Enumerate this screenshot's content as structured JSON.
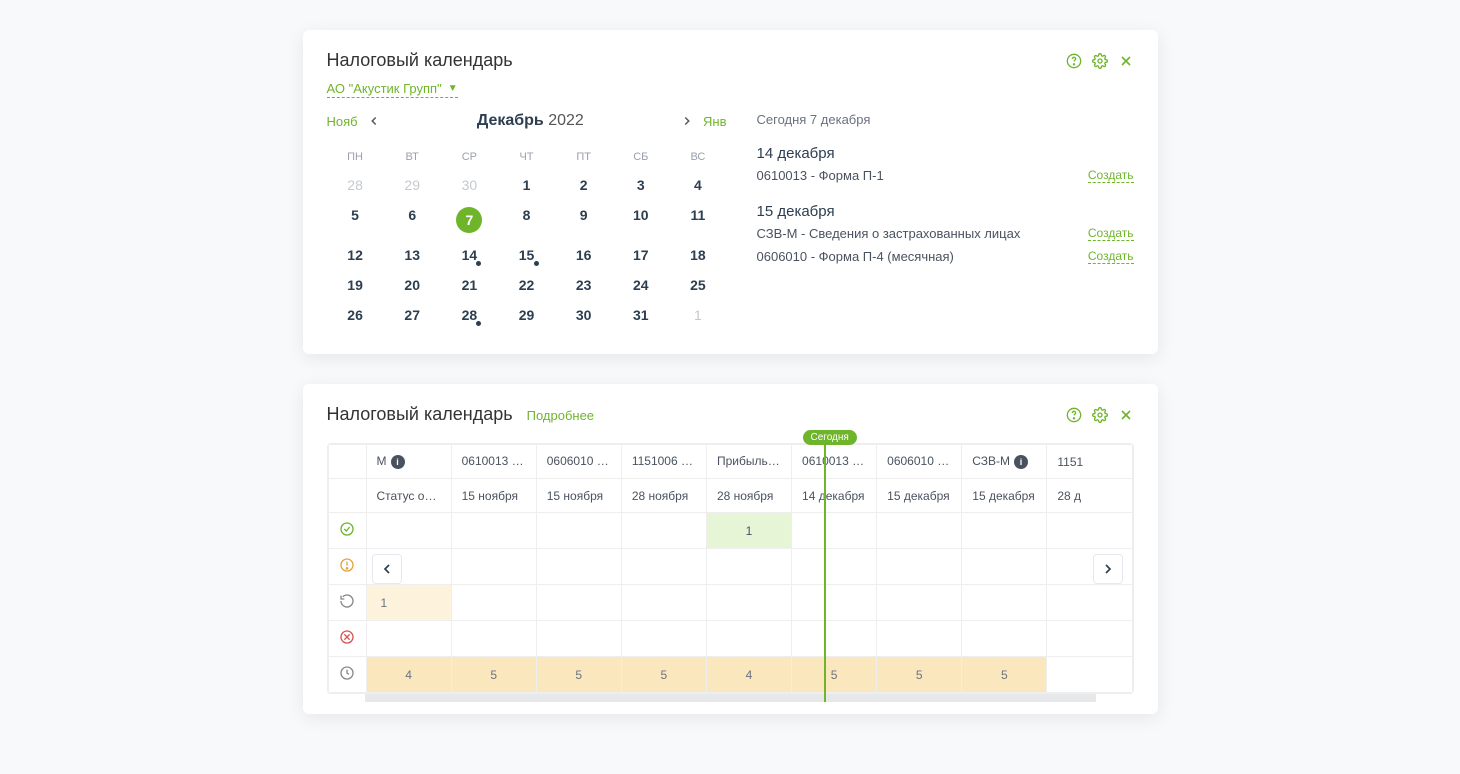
{
  "panel1": {
    "title": "Налоговый календарь",
    "company": "АО \"Акустик Групп\"",
    "nav": {
      "prev": "Нояб",
      "month": "Декабрь",
      "year": "2022",
      "next": "Янв"
    },
    "weekdays": [
      "ПН",
      "ВТ",
      "СР",
      "ЧТ",
      "ПТ",
      "СБ",
      "ВС"
    ],
    "weeks": [
      [
        {
          "d": "28",
          "other": true
        },
        {
          "d": "29",
          "other": true
        },
        {
          "d": "30",
          "other": true
        },
        {
          "d": "1"
        },
        {
          "d": "2"
        },
        {
          "d": "3"
        },
        {
          "d": "4"
        }
      ],
      [
        {
          "d": "5"
        },
        {
          "d": "6"
        },
        {
          "d": "7",
          "today": true
        },
        {
          "d": "8"
        },
        {
          "d": "9"
        },
        {
          "d": "10"
        },
        {
          "d": "11"
        }
      ],
      [
        {
          "d": "12"
        },
        {
          "d": "13"
        },
        {
          "d": "14",
          "dot": true
        },
        {
          "d": "15",
          "dot": true
        },
        {
          "d": "16"
        },
        {
          "d": "17"
        },
        {
          "d": "18"
        }
      ],
      [
        {
          "d": "19"
        },
        {
          "d": "20"
        },
        {
          "d": "21"
        },
        {
          "d": "22"
        },
        {
          "d": "23"
        },
        {
          "d": "24"
        },
        {
          "d": "25"
        }
      ],
      [
        {
          "d": "26"
        },
        {
          "d": "27"
        },
        {
          "d": "28",
          "dot": true
        },
        {
          "d": "29"
        },
        {
          "d": "30"
        },
        {
          "d": "31"
        },
        {
          "d": "1",
          "other": true
        }
      ]
    ],
    "today_label": "Сегодня 7 декабря",
    "events": [
      {
        "date": "14 декабря",
        "items": [
          {
            "desc": "0610013 - Форма П-1",
            "action": "Создать"
          }
        ]
      },
      {
        "date": "15 декабря",
        "items": [
          {
            "desc": "СЗВ-М - Сведения о застрахованных лицах",
            "action": "Создать"
          },
          {
            "desc": "0606010 - Форма П-4 (месячная)",
            "action": "Создать"
          }
        ]
      }
    ]
  },
  "panel2": {
    "title": "Налоговый календарь",
    "detail": "Подробнее",
    "today_pill": "Сегодня",
    "columns": [
      {
        "head": "М",
        "info": true,
        "date": "Статус оября"
      },
      {
        "head": "0610013 - ...",
        "info": true,
        "date": "15 ноября"
      },
      {
        "head": "0606010 - ...",
        "info": true,
        "date": "15 ноября"
      },
      {
        "head": "1151006 - ...",
        "info": true,
        "date": "28 ноября"
      },
      {
        "head": "Прибыль",
        "info": true,
        "date": "28 ноября"
      },
      {
        "head": "0610013 - ...",
        "info": true,
        "date": "14 декабря"
      },
      {
        "head": "0606010 - ...",
        "info": true,
        "date": "15 декабря"
      },
      {
        "head": "СЗВ-М",
        "info": true,
        "date": "15 декабря"
      },
      {
        "head": "1151",
        "info": false,
        "date": "28 д"
      }
    ],
    "rows": {
      "green": [
        "",
        "",
        "",
        "",
        "1",
        "",
        "",
        "",
        ""
      ],
      "orange": [
        "",
        "",
        "",
        "",
        "",
        "",
        "",
        "",
        ""
      ],
      "cream": [
        "1",
        "",
        "",
        "",
        "",
        "",
        "",
        "",
        ""
      ],
      "red": [
        "",
        "",
        "",
        "",
        "",
        "",
        "",
        "",
        ""
      ],
      "gold": [
        "4",
        "5",
        "5",
        "5",
        "4",
        "5",
        "5",
        "5",
        ""
      ]
    }
  }
}
